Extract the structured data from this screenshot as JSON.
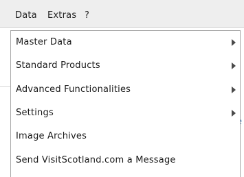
{
  "menubar": {
    "items": [
      {
        "label": "Data"
      },
      {
        "label": "Extras"
      },
      {
        "label": "?"
      }
    ]
  },
  "background": {
    "partial_glyph": "e"
  },
  "dropdown": {
    "items": [
      {
        "label": "Master Data",
        "has_submenu": true
      },
      {
        "label": "Standard Products",
        "has_submenu": true
      },
      {
        "label": "Advanced Functionalities",
        "has_submenu": true
      },
      {
        "label": "Settings",
        "has_submenu": true
      },
      {
        "label": "Image Archives",
        "has_submenu": false
      },
      {
        "label": "Send VisitScotland.com a Message",
        "has_submenu": false
      }
    ]
  },
  "colors": {
    "menubar_bg": "#eeeeee",
    "menu_border": "#a9a9a9",
    "text": "#1a1a1a",
    "link": "#2a6db0"
  }
}
